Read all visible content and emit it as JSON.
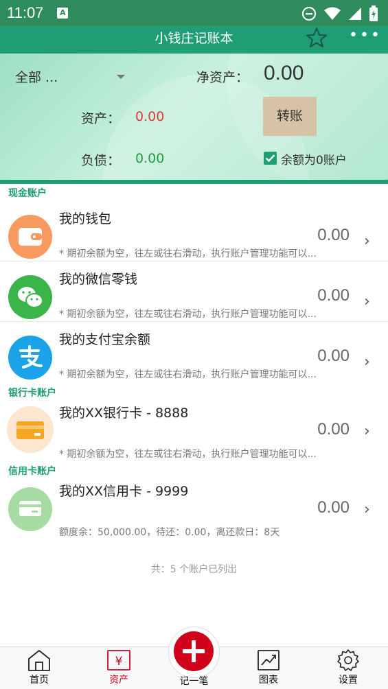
{
  "status_bar": {
    "time": "11:07",
    "notif_letter": "A"
  },
  "app_bar": {
    "title": "小钱庄记账本"
  },
  "summary": {
    "filter": "全部 ...",
    "net_assets_label": "净资产：",
    "net_assets_value": "0.00",
    "assets_label": "资产：",
    "assets_value": "0.00",
    "transfer_button": "转账",
    "liabilities_label": "负债：",
    "liabilities_value": "0.00",
    "zero_balance_label": "余额为0账户",
    "zero_balance_checked": true
  },
  "sections": [
    {
      "title": "现金账户",
      "accounts": [
        {
          "name": "我的钱包",
          "amount": "0.00",
          "note": "* 期初余额为空，往左或往右滑动，执行账户管理功能可以...",
          "icon": "wallet-icon",
          "color": "#f79a5f"
        },
        {
          "name": "我的微信零钱",
          "amount": "0.00",
          "note": "* 期初余额为空，往左或往右滑动，执行账户管理功能可以...",
          "icon": "wechat-icon",
          "color": "#3bb54a"
        },
        {
          "name": "我的支付宝余额",
          "amount": "0.00",
          "note": "* 期初余额为空，往左或往右滑动，执行账户管理功能可以...",
          "icon": "alipay-icon",
          "color": "#1aa3e8"
        }
      ]
    },
    {
      "title": "银行卡账户",
      "accounts": [
        {
          "name": "我的XX银行卡 - 8888",
          "amount": "0.00",
          "note": "* 期初余额为空，往左或往右滑动，执行账户管理功能可以...",
          "icon": "bank-card-icon",
          "color": "#fde6cf"
        }
      ]
    },
    {
      "title": "信用卡账户",
      "accounts": [
        {
          "name": "我的XX信用卡 - 9999",
          "amount": "0.00",
          "note": "额度余：50,000.00，待还：0.00，离还款日：8天",
          "icon": "credit-card-icon",
          "color": "#a6dba3"
        }
      ]
    }
  ],
  "total_line": "共：5 个账户已列出",
  "bottom_nav": {
    "home": "首页",
    "assets": "资产",
    "add": "记一笔",
    "charts": "图表",
    "settings": "设置",
    "active": "assets"
  },
  "colors": {
    "primary": "#1f9e76",
    "accent_red": "#d0021b",
    "asset_red": "#e0393b",
    "debt_green": "#1f9e3e"
  }
}
